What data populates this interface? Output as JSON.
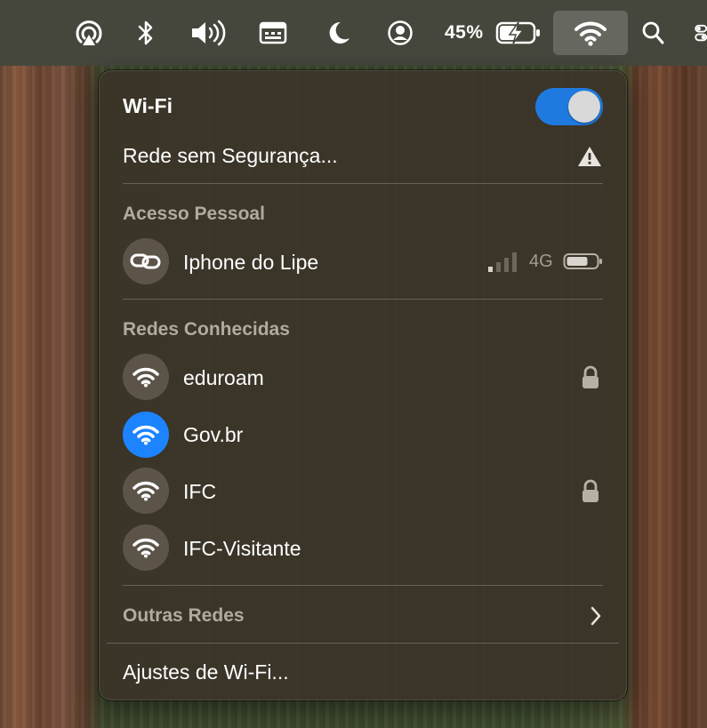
{
  "menubar": {
    "battery_percent": "45%",
    "icons": [
      "airplay-icon",
      "bluetooth-icon",
      "volume-icon",
      "keyboard-icon",
      "focus-moon-icon",
      "user-icon",
      "battery-charging-icon",
      "wifi-icon",
      "search-icon",
      "control-center-icon"
    ]
  },
  "wifi_panel": {
    "title": "Wi-Fi",
    "toggle_on": true,
    "current_network": "Rede sem Segurança...",
    "sections": {
      "personal_hotspot": "Acesso Pessoal",
      "known_networks": "Redes Conhecidas",
      "other_networks": "Outras Redes"
    },
    "hotspot": {
      "name": "Iphone do Lipe",
      "network_type": "4G",
      "signal_bars": 1
    },
    "known_networks": [
      {
        "name": "eduroam",
        "locked": true,
        "active": false
      },
      {
        "name": "Gov.br",
        "locked": false,
        "active": true
      },
      {
        "name": "IFC",
        "locked": true,
        "active": false
      },
      {
        "name": "IFC-Visitante",
        "locked": false,
        "active": false
      }
    ],
    "settings_label": "Ajustes de Wi-Fi..."
  },
  "colors": {
    "accent": "#1c84ff",
    "toggle": "#1f7ae0",
    "section_text": "#b3aa9f"
  }
}
